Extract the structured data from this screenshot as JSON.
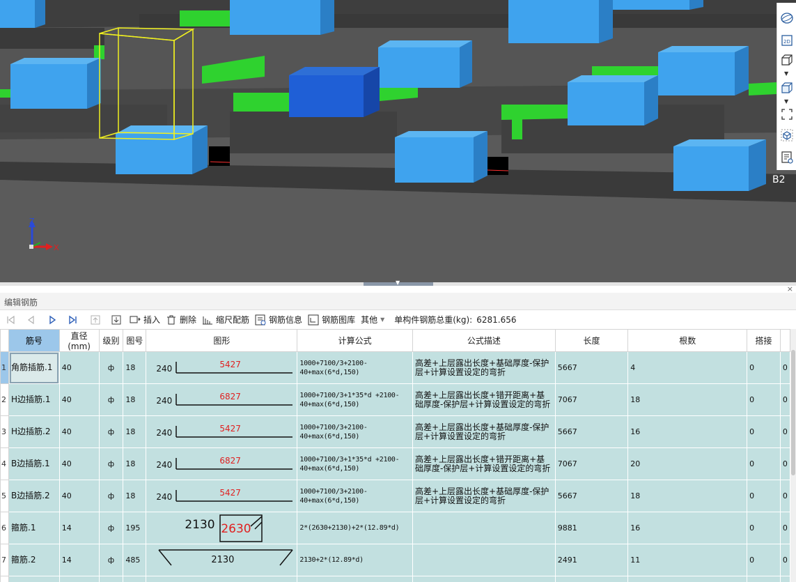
{
  "viewport": {
    "axis": {
      "z": "Z",
      "x": "X"
    },
    "corner_label": "B2",
    "toolbar_icons": [
      "sphere-view-icon",
      "2d-view-icon",
      "cube-view-icon",
      "box-3d-icon",
      "fullscreen-icon",
      "rotate-cube-icon",
      "list-view-icon"
    ]
  },
  "panel": {
    "title": "编辑钢筋",
    "close": "×"
  },
  "toolbar": {
    "insert": "插入",
    "delete": "删除",
    "scale": "缩尺配筋",
    "info": "钢筋信息",
    "library": "钢筋图库",
    "other": "其他",
    "total_label": "单构件钢筋总重(kg):",
    "total_value": "6281.656"
  },
  "table": {
    "columns": [
      "筋号",
      "直径(mm)",
      "级别",
      "图号",
      "图形",
      "计算公式",
      "公式描述",
      "长度",
      "根数",
      "搭接",
      ""
    ],
    "rows": [
      {
        "no": "1",
        "name": "角筋插筋.1",
        "dia": "40",
        "grade": "ф",
        "fig": "18",
        "shape": {
          "kind": "L",
          "left": "240",
          "top": "5427"
        },
        "formula": "1000+7100/3+2100-40+max(6*d,150)",
        "desc": "高差+上层露出长度+基础厚度-保护层+计算设置设定的弯折",
        "length": "5667",
        "count": "4",
        "lap": "0",
        "extra": "0"
      },
      {
        "no": "2",
        "name": "H边插筋.1",
        "dia": "40",
        "grade": "ф",
        "fig": "18",
        "shape": {
          "kind": "L",
          "left": "240",
          "top": "6827"
        },
        "formula": "1000+7100/3+1*35*d +2100-40+max(6*d,150)",
        "desc": "高差+上层露出长度+错开距离+基础厚度-保护层+计算设置设定的弯折",
        "length": "7067",
        "count": "18",
        "lap": "0",
        "extra": "0"
      },
      {
        "no": "3",
        "name": "H边插筋.2",
        "dia": "40",
        "grade": "ф",
        "fig": "18",
        "shape": {
          "kind": "L",
          "left": "240",
          "top": "5427"
        },
        "formula": "1000+7100/3+2100-40+max(6*d,150)",
        "desc": "高差+上层露出长度+基础厚度-保护层+计算设置设定的弯折",
        "length": "5667",
        "count": "16",
        "lap": "0",
        "extra": "0"
      },
      {
        "no": "4",
        "name": "B边插筋.1",
        "dia": "40",
        "grade": "ф",
        "fig": "18",
        "shape": {
          "kind": "L",
          "left": "240",
          "top": "6827"
        },
        "formula": "1000+7100/3+1*35*d +2100-40+max(6*d,150)",
        "desc": "高差+上层露出长度+错开距离+基础厚度-保护层+计算设置设定的弯折",
        "length": "7067",
        "count": "20",
        "lap": "0",
        "extra": "0"
      },
      {
        "no": "5",
        "name": "B边插筋.2",
        "dia": "40",
        "grade": "ф",
        "fig": "18",
        "shape": {
          "kind": "L",
          "left": "240",
          "top": "5427"
        },
        "formula": "1000+7100/3+2100-40+max(6*d,150)",
        "desc": "高差+上层露出长度+基础厚度-保护层+计算设置设定的弯折",
        "length": "5667",
        "count": "18",
        "lap": "0",
        "extra": "0"
      },
      {
        "no": "6",
        "name": "箍筋.1",
        "dia": "14",
        "grade": "ф",
        "fig": "195",
        "shape": {
          "kind": "stirrup",
          "left": "2130",
          "top": "2630"
        },
        "formula": "2*(2630+2130)+2*(12.89*d)",
        "desc": "",
        "length": "9881",
        "count": "16",
        "lap": "0",
        "extra": "0"
      },
      {
        "no": "7",
        "name": "箍筋.2",
        "dia": "14",
        "grade": "ф",
        "fig": "485",
        "shape": {
          "kind": "hook",
          "left": "",
          "top": "2130"
        },
        "formula": "2130+2*(12.89*d)",
        "desc": "",
        "length": "2491",
        "count": "11",
        "lap": "0",
        "extra": "0"
      }
    ]
  }
}
